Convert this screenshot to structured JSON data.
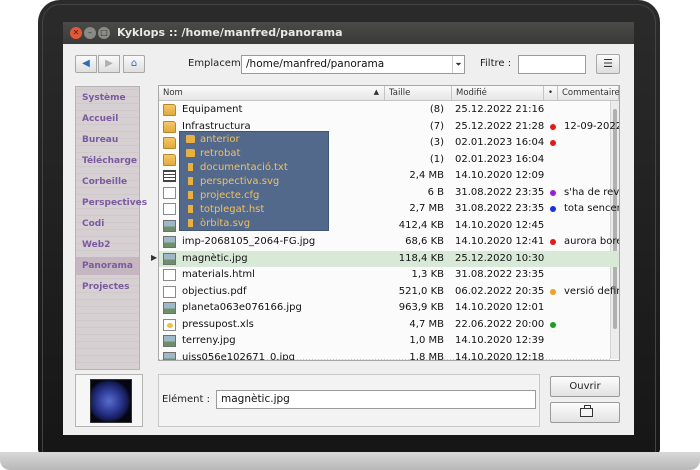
{
  "window": {
    "app_name": "Kyklops",
    "title": "Kyklops :: /home/manfred/panorama",
    "buttons": {
      "close": "✕",
      "minimize": "–",
      "maximize": "□"
    }
  },
  "toolbar": {
    "back_icon": "◀",
    "forward_icon": "▶",
    "home_icon": "⌂",
    "location_label": "Emplacement :",
    "location_value": "/home/manfred/panorama",
    "location_dropdown_icon": "⏷",
    "filter_label": "Filtre :",
    "filter_value": "",
    "menu_icon": "☰"
  },
  "sidebar": {
    "items": [
      {
        "label": "Système",
        "active": false
      },
      {
        "label": "Accueil",
        "active": false
      },
      {
        "label": "Bureau",
        "active": false
      },
      {
        "label": "Télécharge",
        "active": false
      },
      {
        "label": "Corbeille",
        "active": false
      },
      {
        "label": "Perspectives",
        "active": false
      },
      {
        "label": "Codi",
        "active": false
      },
      {
        "label": "Web2",
        "active": false
      },
      {
        "label": "Panorama",
        "active": true
      },
      {
        "label": "Projectes",
        "active": false
      }
    ]
  },
  "columns": {
    "name": "Nom",
    "name_sort_icon": "▲",
    "size": "Taille",
    "modified": "Modifié",
    "tag": "•",
    "comment": "Commentaire"
  },
  "files": [
    {
      "icon": "folder",
      "name": "Equipament",
      "size": "(8)",
      "date": "25.12.2022 21:16",
      "dot": "",
      "comment": ""
    },
    {
      "icon": "folder",
      "name": "Infrastructura",
      "size": "(7)",
      "date": "25.12.2022 21:28",
      "dot": "#e01b1b",
      "comment": "12-09-2022"
    },
    {
      "icon": "folder",
      "name": "",
      "size": "(3)",
      "date": "02.01.2023 16:04",
      "dot": "#e01b1b",
      "comment": ""
    },
    {
      "icon": "folder",
      "name": "",
      "size": "(1)",
      "date": "02.01.2023 16:04",
      "dot": "",
      "comment": ""
    },
    {
      "icon": "table",
      "name": "",
      "size": "2,4 MB",
      "date": "14.10.2020 12:09",
      "dot": "",
      "comment": ""
    },
    {
      "icon": "doc",
      "name": "",
      "size": "6 B",
      "date": "31.08.2022 23:35",
      "dot": "#9a1ed8",
      "comment": "s'ha de revisar"
    },
    {
      "icon": "doc",
      "name": "",
      "size": "2,7 MB",
      "date": "31.08.2022 23:35",
      "dot": "#1a2fe0",
      "comment": "tota sencera"
    },
    {
      "icon": "img",
      "name": "",
      "size": "412,4 KB",
      "date": "14.10.2020 12:45",
      "dot": "",
      "comment": ""
    },
    {
      "icon": "img",
      "name": "imp-2068105_2064-FG.jpg",
      "size": "68,6 KB",
      "date": "14.10.2020 12:41",
      "dot": "#e01b1b",
      "comment": "aurora boreal"
    },
    {
      "icon": "img",
      "name": "magnètic.jpg",
      "size": "118,4 KB",
      "date": "25.12.2020 10:30",
      "dot": "",
      "comment": "",
      "selected": true
    },
    {
      "icon": "doc",
      "name": "materials.html",
      "size": "1,3 KB",
      "date": "31.08.2022 23:35",
      "dot": "",
      "comment": ""
    },
    {
      "icon": "doc",
      "name": "objectius.pdf",
      "size": "521,0 KB",
      "date": "06.02.2022 20:35",
      "dot": "#f0a020",
      "comment": "versió definitiva"
    },
    {
      "icon": "img",
      "name": "planeta063e076166.jpg",
      "size": "963,9 KB",
      "date": "14.10.2020 12:01",
      "dot": "",
      "comment": ""
    },
    {
      "icon": "sheet",
      "name": "pressupost.xls",
      "size": "4,7 MB",
      "date": "22.06.2022 20:00",
      "dot": "#1aa020",
      "comment": ""
    },
    {
      "icon": "img",
      "name": "terreny.jpg",
      "size": "1,0 MB",
      "date": "14.10.2020 12:39",
      "dot": "",
      "comment": ""
    },
    {
      "icon": "img",
      "name": "uiss056e102671_0.jpg",
      "size": "1,8 MB",
      "date": "14.10.2020 12:18",
      "dot": "",
      "comment": ""
    }
  ],
  "popup": {
    "items": [
      {
        "kind": "folder",
        "label": "anterior"
      },
      {
        "kind": "folder",
        "label": "retrobat"
      },
      {
        "kind": "doc",
        "label": "documentació.txt"
      },
      {
        "kind": "doc",
        "label": "perspectiva.svg"
      },
      {
        "kind": "doc",
        "label": "projecte.cfg"
      },
      {
        "kind": "doc",
        "label": "totplegat.hst"
      },
      {
        "kind": "doc",
        "label": "òrbita.svg"
      }
    ]
  },
  "bottom": {
    "element_label": "Elément :",
    "element_value": "magnètic.jpg",
    "open_label": "Ouvrir",
    "case_icon": "briefcase-icon"
  }
}
